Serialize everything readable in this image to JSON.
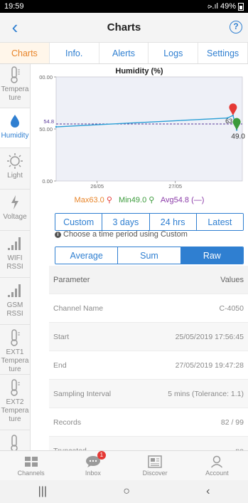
{
  "status_bar": {
    "time": "19:59",
    "signal": "⪧.ıl",
    "battery": "49%"
  },
  "header": {
    "back": "‹",
    "title": "Charts",
    "help": "?"
  },
  "tabs": [
    "Charts",
    "Info.",
    "Alerts",
    "Logs",
    "Settings"
  ],
  "sidebar": {
    "items": [
      {
        "label": "Tempera ture",
        "icon": "thermometer-icon"
      },
      {
        "label": "Humidity",
        "icon": "water-drop-icon"
      },
      {
        "label": "Light",
        "icon": "sun-icon"
      },
      {
        "label": "Voltage",
        "icon": "bolt-icon"
      },
      {
        "label": "WIFI RSSI",
        "icon": "signal-bars-icon"
      },
      {
        "label": "GSM RSSI",
        "icon": "signal-bars-icon"
      },
      {
        "label": "EXT1 Tempera ture",
        "icon": "thermometer-icon"
      },
      {
        "label": "EXT2 Tempera ture",
        "icon": "thermometer-icon"
      },
      {
        "label": "",
        "icon": "thermometer-icon"
      }
    ]
  },
  "chart_data": {
    "type": "line",
    "title": "Humidity (%)",
    "x_ticks": [
      "26/05",
      "27/05"
    ],
    "y_ticks": [
      "00.00",
      "50.00",
      "0.00"
    ],
    "avg_label": "54.8",
    "annotations": [
      "63.0",
      "49.0"
    ],
    "series": [
      {
        "name": "Humidity",
        "x": [
          "25/05 17:56",
          "27/05 19:35",
          "27/05 19:42",
          "27/05 19:47"
        ],
        "values": [
          52.0,
          60.5,
          63.0,
          49.0
        ]
      }
    ],
    "avg": 54.8,
    "max": 63.0,
    "min": 49.0,
    "ylim": [
      0,
      100
    ],
    "legend": {
      "max": "Max63.0",
      "min": "Min49.0",
      "avg": "Avg54.8 (—)"
    }
  },
  "period_buttons": [
    "Custom",
    "3 days",
    "24 hrs",
    "Latest"
  ],
  "hint": "Choose a time period using Custom",
  "mode_buttons": [
    "Average",
    "Sum",
    "Raw"
  ],
  "active_mode": "Raw",
  "table": {
    "header": {
      "param": "Parameter",
      "value": "Values"
    },
    "rows": [
      {
        "param": "Channel Name",
        "value": "C-4050"
      },
      {
        "param": "Start",
        "value": "25/05/2019 17:56:45"
      },
      {
        "param": "End",
        "value": "27/05/2019 19:47:28"
      },
      {
        "param": "Sampling Interval",
        "value": "5 mins (Tolerance: 1.1)"
      },
      {
        "param": "Records",
        "value": "82 / 99"
      },
      {
        "param": "Truncated",
        "value": "no"
      }
    ]
  },
  "bottom_nav": {
    "items": [
      {
        "label": "Channels",
        "icon": "grid-icon"
      },
      {
        "label": "Inbox",
        "icon": "chat-bubble-icon",
        "badge": "1"
      },
      {
        "label": "Discover",
        "icon": "newspaper-icon"
      },
      {
        "label": "Account",
        "icon": "person-icon"
      }
    ]
  },
  "system_nav": {
    "recents": "|||",
    "home": "○",
    "back": "‹"
  },
  "colors": {
    "accent": "#2f7fd1",
    "active_tab": "#e8852a",
    "max": "#e8852a",
    "min": "#3a9a3a",
    "avg": "#8a3aa8"
  }
}
